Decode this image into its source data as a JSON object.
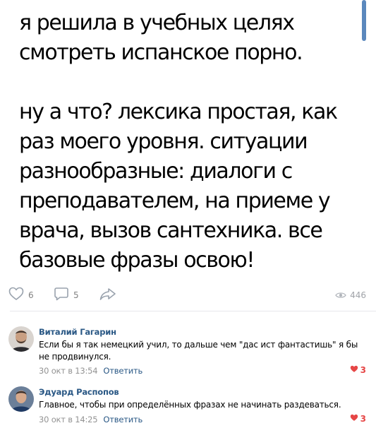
{
  "post": {
    "text": "я решила в учебных целях\nсмотреть испанское порно.\n\nну а что? лексика простая, как\nраз моего уровня. ситуации\nразнообразные: диалоги с\nпреподавателем, на приеме у\nврача, вызов сантехника. все\nбазовые фразы освою!"
  },
  "actions": {
    "likes": "6",
    "comments": "5",
    "views": "446"
  },
  "colors": {
    "accent": "#2a5885",
    "heart": "#e64646",
    "muted": "#828282"
  },
  "comments": [
    {
      "author": "Виталий Гагарин",
      "text": "Если бы я так немецкий учил, то дальше чем \"дас ист фантастишь\" я бы не продвинулся.",
      "time": "30 окт в 13:54",
      "reply_label": "Ответить",
      "likes": "3"
    },
    {
      "author": "Эдуард Распопов",
      "text": "Главное, чтобы при определённых фразах не начинать раздеваться.",
      "time": "30 окт в 14:25",
      "reply_label": "Ответить",
      "likes": "3"
    }
  ]
}
